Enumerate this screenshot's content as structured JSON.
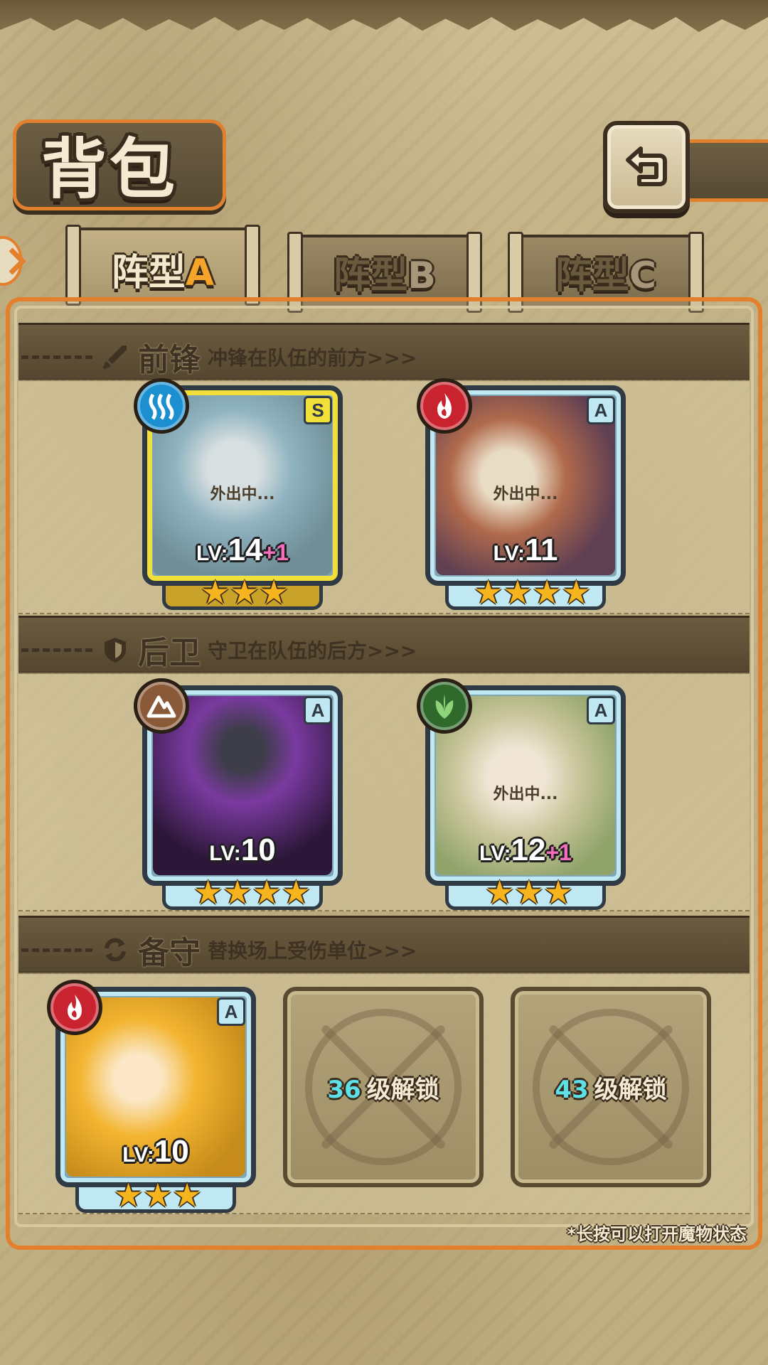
{
  "header": {
    "title": "背包"
  },
  "tabs": [
    {
      "label": "阵型",
      "letter": "A",
      "active": true
    },
    {
      "label": "阵型",
      "letter": "B",
      "active": false
    },
    {
      "label": "阵型",
      "letter": "C",
      "active": false
    }
  ],
  "sections": {
    "vanguard": {
      "title": "前锋",
      "desc": "冲锋在队伍的前方>>>"
    },
    "rear": {
      "title": "后卫",
      "desc": "守卫在队伍的后方>>>"
    },
    "reserve": {
      "title": "备守",
      "desc": "替换场上受伤单位>>>"
    }
  },
  "cards": [
    {
      "rarity": "S",
      "element": "water",
      "status": "外出中...",
      "level_prefix": "LV:",
      "level": "14",
      "bonus": "+1",
      "stars": 3
    },
    {
      "rarity": "A",
      "element": "fire",
      "status": "外出中...",
      "level_prefix": "LV:",
      "level": "11",
      "bonus": "",
      "stars": 4
    },
    {
      "rarity": "A",
      "element": "earth",
      "status": "",
      "level_prefix": "LV:",
      "level": "10",
      "bonus": "",
      "stars": 4
    },
    {
      "rarity": "A",
      "element": "wood",
      "status": "外出中...",
      "level_prefix": "LV:",
      "level": "12",
      "bonus": "+1",
      "stars": 3
    },
    {
      "rarity": "A",
      "element": "fire",
      "status": "",
      "level_prefix": "LV:",
      "level": "10",
      "bonus": "",
      "stars": 3
    }
  ],
  "locked_slots": [
    {
      "level": "36",
      "label": "级解锁"
    },
    {
      "level": "43",
      "label": "级解锁"
    }
  ],
  "hint": "*长按可以打开魔物状态",
  "colors": {
    "accent_orange": "#e2802e",
    "gold_frame": "#f1df3a",
    "blue_frame": "#bfe8f2",
    "bonus_pink": "#f46dbb",
    "unlock_cyan": "#5ee0e8"
  }
}
